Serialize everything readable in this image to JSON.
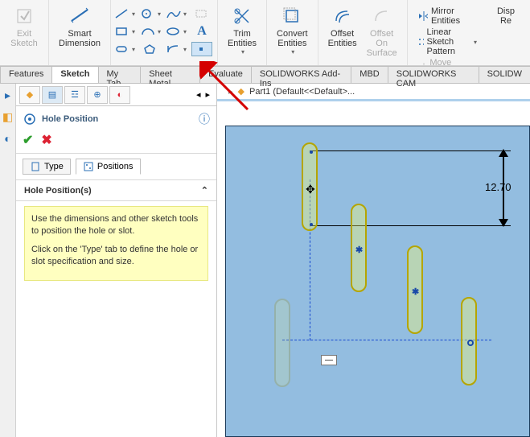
{
  "ribbon": {
    "exit_sketch": "Exit\nSketch",
    "smart_dimension": "Smart\nDimension",
    "trim_entities": "Trim\nEntities",
    "convert_entities": "Convert\nEntities",
    "offset_entities": "Offset\nEntities",
    "offset_on_surface": "Offset\nOn\nSurface",
    "display_relations": "Disp\nRe",
    "mirror_entities": "Mirror Entities",
    "linear_sketch_pattern": "Linear Sketch Pattern",
    "move_entities": "Move Entities"
  },
  "tabs": {
    "features": "Features",
    "sketch": "Sketch",
    "my_tab": "My Tab",
    "sheet_metal": "Sheet Metal",
    "evaluate": "Evaluate",
    "addins": "SOLIDWORKS Add-Ins",
    "mbd": "MBD",
    "cam": "SOLIDWORKS CAM",
    "solidw": "SOLIDW"
  },
  "document": {
    "title": "Part1 (Default<<Default>..."
  },
  "panel": {
    "title": "Hole Position",
    "type_tab": "Type",
    "positions_tab": "Positions",
    "section_title": "Hole Position(s)",
    "help_para1": "Use the dimensions and other sketch tools to position the hole or slot.",
    "help_para2": "Click on the 'Type' tab to define the hole or slot specification and size."
  },
  "dimension": {
    "value": "12.70"
  },
  "relation_tag": "—"
}
